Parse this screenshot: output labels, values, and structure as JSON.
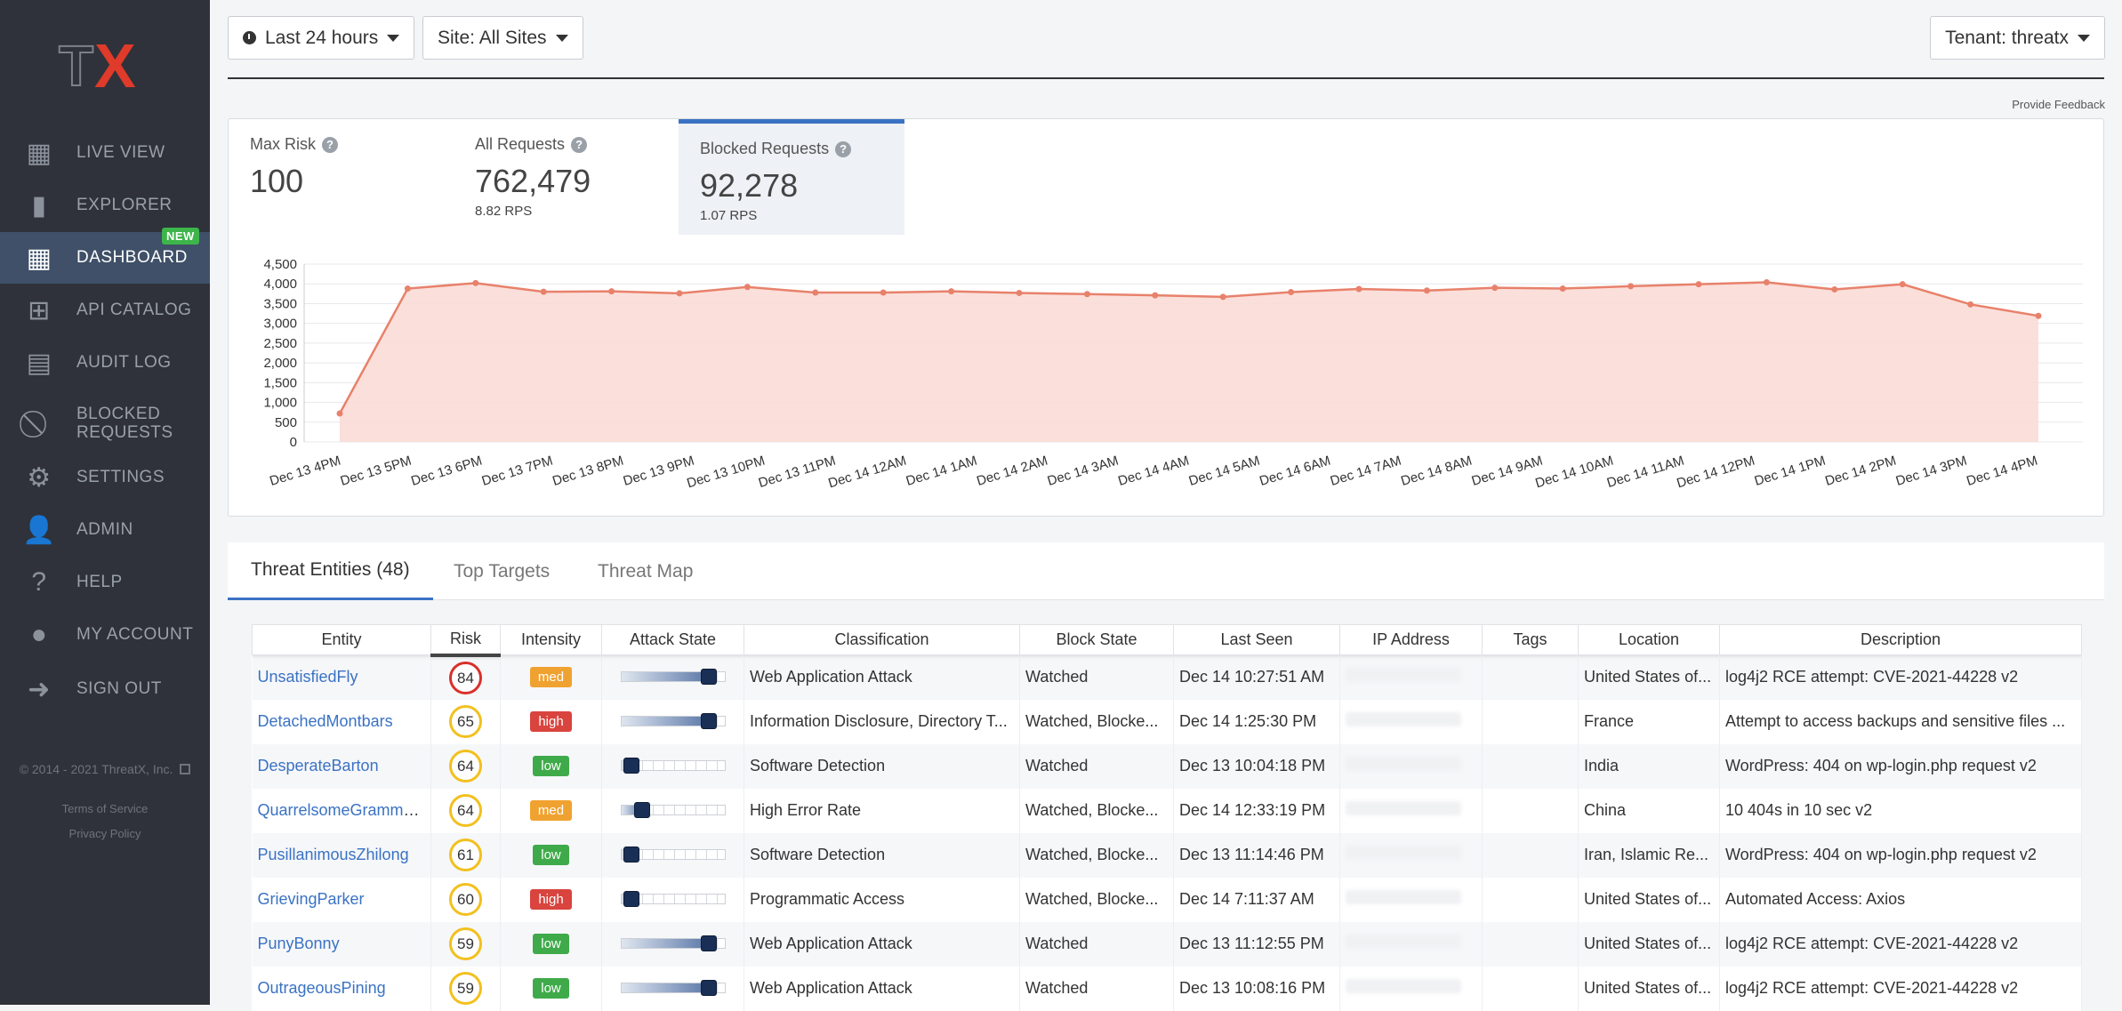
{
  "sidebar": {
    "logo_text": "TX",
    "items": [
      {
        "label": "LIVE VIEW",
        "icon": "grid-icon"
      },
      {
        "label": "EXPLORER",
        "icon": "bar-chart-icon"
      },
      {
        "label": "DASHBOARD",
        "icon": "dashboard-icon",
        "badge": "NEW"
      },
      {
        "label": "API CATALOG",
        "icon": "api-catalog-icon"
      },
      {
        "label": "AUDIT LOG",
        "icon": "audit-log-icon"
      },
      {
        "label": "BLOCKED",
        "label2": "REQUESTS",
        "icon": "blocked-icon"
      },
      {
        "label": "SETTINGS",
        "icon": "gear-icon"
      },
      {
        "label": "ADMIN",
        "icon": "admin-user-icon"
      },
      {
        "label": "HELP",
        "icon": "question-icon"
      },
      {
        "label": "MY ACCOUNT",
        "icon": "user-icon"
      },
      {
        "label": "SIGN OUT",
        "icon": "sign-out-icon"
      }
    ],
    "copyright": "© 2014 - 2021 ThreatX, Inc.",
    "terms": "Terms of Service",
    "privacy": "Privacy Policy"
  },
  "topbar": {
    "time_range": "Last 24 hours",
    "site": "Site: All Sites",
    "tenant": "Tenant: threatx",
    "feedback": "Provide Feedback"
  },
  "stats": [
    {
      "title": "Max Risk",
      "value": "100",
      "sub": ""
    },
    {
      "title": "All Requests",
      "value": "762,479",
      "sub": "8.82 RPS"
    },
    {
      "title": "Blocked Requests",
      "value": "92,278",
      "sub": "1.07 RPS"
    }
  ],
  "accent_color": "#3a72c4",
  "chart_data": {
    "type": "area",
    "series": [
      {
        "values": [
          720,
          3880,
          4020,
          3800,
          3810,
          3760,
          3920,
          3780,
          3780,
          3810,
          3770,
          3740,
          3710,
          3670,
          3790,
          3870,
          3830,
          3900,
          3880,
          3940,
          3990,
          4040,
          3860,
          3990,
          3480,
          3190
        ]
      }
    ],
    "categories": [
      "Dec 13 4PM",
      "Dec 13 5PM",
      "Dec 13 6PM",
      "Dec 13 7PM",
      "Dec 13 8PM",
      "Dec 13 9PM",
      "Dec 13 10PM",
      "Dec 13 11PM",
      "Dec 14 12AM",
      "Dec 14 1AM",
      "Dec 14 2AM",
      "Dec 14 3AM",
      "Dec 14 4AM",
      "Dec 14 5AM",
      "Dec 14 6AM",
      "Dec 14 7AM",
      "Dec 14 8AM",
      "Dec 14 9AM",
      "Dec 14 10AM",
      "Dec 14 11AM",
      "Dec 14 12PM",
      "Dec 14 1PM",
      "Dec 14 2PM",
      "Dec 14 3PM",
      "Dec 14 4PM"
    ],
    "ylim": [
      0,
      4500
    ],
    "yticks": [
      "4,500",
      "4,000",
      "3,500",
      "3,000",
      "2,500",
      "2,000",
      "1,500",
      "1,000",
      "500",
      "0"
    ],
    "line_color": "#e8816b",
    "fill_color": "#fbdcd6",
    "grid": true
  },
  "tabs": [
    "Threat Entities (48)",
    "Top Targets",
    "Threat Map"
  ],
  "table": {
    "columns": [
      "Entity",
      "Risk",
      "Intensity",
      "Attack State",
      "Classification",
      "Block State",
      "Last Seen",
      "IP Address",
      "Tags",
      "Location",
      "Description"
    ],
    "rows": [
      {
        "entity": "UnsatisfiedFly",
        "risk": "84",
        "risk_color": "red",
        "intensity": "med",
        "attack_state": 0.85,
        "classification": "Web Application Attack",
        "block_state": "Watched",
        "last_seen": "Dec 14 10:27:51 AM",
        "location": "United States of...",
        "description": "log4j2 RCE attempt: CVE-2021-44228 v2"
      },
      {
        "entity": "DetachedMontbars",
        "risk": "65",
        "risk_color": "yellow",
        "intensity": "high",
        "attack_state": 0.85,
        "classification": "Information Disclosure, Directory T...",
        "block_state": "Watched, Blocke...",
        "last_seen": "Dec 14 1:25:30 PM",
        "location": "France",
        "description": "Attempt to access backups and sensitive files ..."
      },
      {
        "entity": "DesperateBarton",
        "risk": "64",
        "risk_color": "yellow",
        "intensity": "low",
        "attack_state": 0.1,
        "classification": "Software Detection",
        "block_state": "Watched",
        "last_seen": "Dec 13 10:04:18 PM",
        "location": "India",
        "description": "WordPress: 404 on wp-login.php request v2"
      },
      {
        "entity": "QuarrelsomeGrammont",
        "risk": "64",
        "risk_color": "yellow",
        "intensity": "med",
        "attack_state": 0.2,
        "classification": "High Error Rate",
        "block_state": "Watched, Blocke...",
        "last_seen": "Dec 14 12:33:19 PM",
        "location": "China",
        "description": "10 404s in 10 sec v2"
      },
      {
        "entity": "PusillanimousZhilong",
        "risk": "61",
        "risk_color": "yellow",
        "intensity": "low",
        "attack_state": 0.1,
        "classification": "Software Detection",
        "block_state": "Watched, Blocke...",
        "last_seen": "Dec 13 11:14:46 PM",
        "location": "Iran, Islamic Re...",
        "description": "WordPress: 404 on wp-login.php request v2"
      },
      {
        "entity": "GrievingParker",
        "risk": "60",
        "risk_color": "yellow",
        "intensity": "high",
        "attack_state": 0.1,
        "classification": "Programmatic Access",
        "block_state": "Watched, Blocke...",
        "last_seen": "Dec 14 7:11:37 AM",
        "location": "United States of...",
        "description": "Automated Access: Axios"
      },
      {
        "entity": "PunyBonny",
        "risk": "59",
        "risk_color": "yellow",
        "intensity": "low",
        "attack_state": 0.85,
        "classification": "Web Application Attack",
        "block_state": "Watched",
        "last_seen": "Dec 13 11:12:55 PM",
        "location": "United States of...",
        "description": "log4j2 RCE attempt: CVE-2021-44228 v2"
      },
      {
        "entity": "OutrageousPining",
        "risk": "59",
        "risk_color": "yellow",
        "intensity": "low",
        "attack_state": 0.85,
        "classification": "Web Application Attack",
        "block_state": "Watched",
        "last_seen": "Dec 13 10:08:16 PM",
        "location": "United States of...",
        "description": "log4j2 RCE attempt: CVE-2021-44228 v2"
      }
    ]
  }
}
